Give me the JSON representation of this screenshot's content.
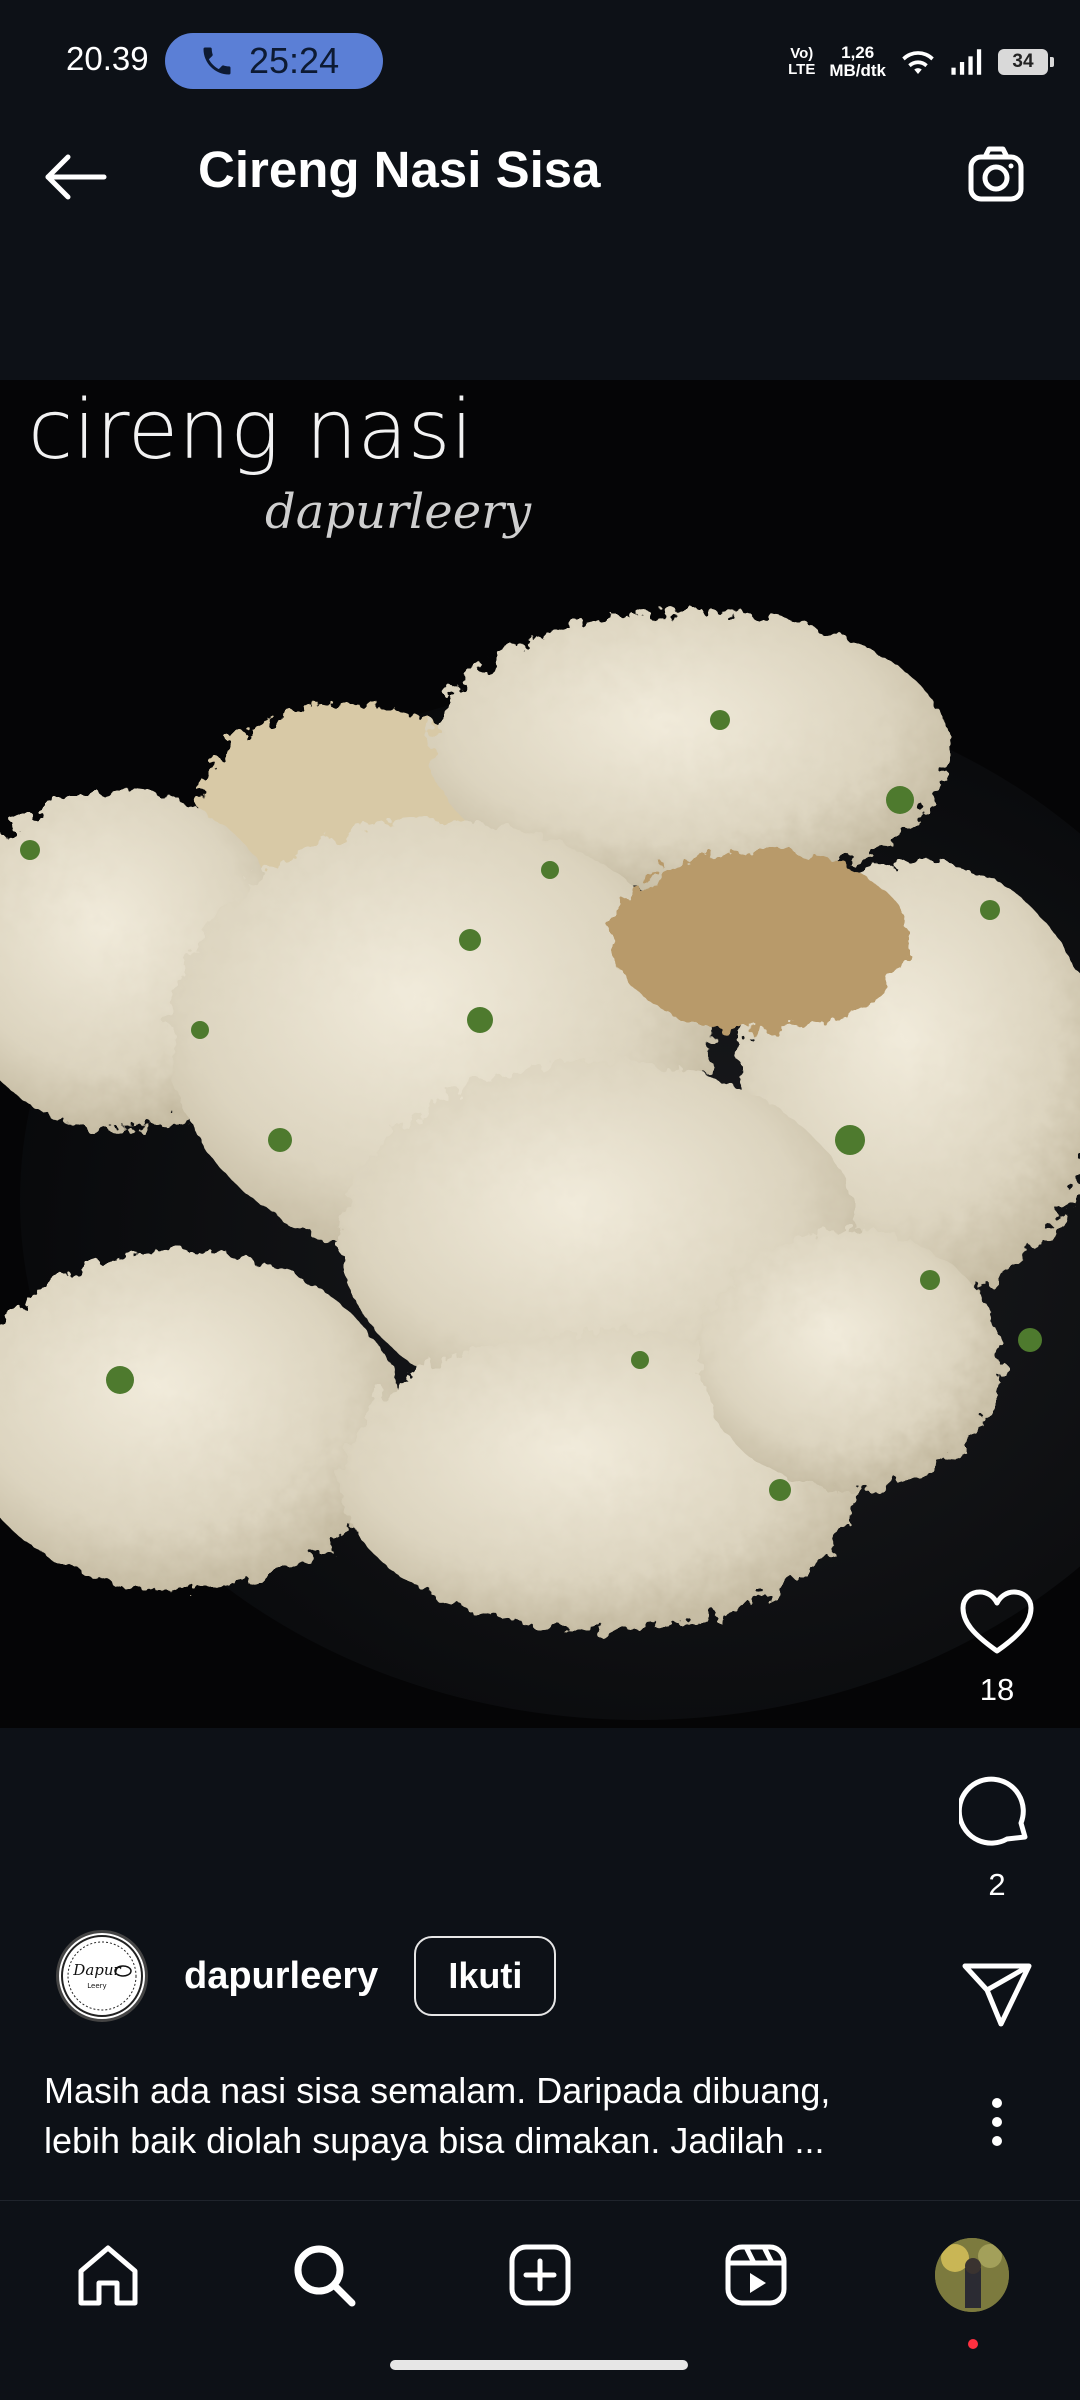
{
  "status_bar": {
    "time": "20.39",
    "call_duration": "25:24",
    "network_label_top": "Vo)",
    "network_label_bottom": "LTE",
    "speed_value": "1,26",
    "speed_unit": "MB/dtk",
    "battery": "34",
    "call_pill_color": "#5b7fd6"
  },
  "header": {
    "title": "Cireng Nasi Sisa",
    "back_icon": "arrow-left-icon",
    "camera_icon": "camera-icon"
  },
  "post": {
    "image_text_title": "cireng nasi",
    "image_text_watermark": "dapurleery",
    "likes": "18",
    "comments": "2",
    "author": {
      "username": "dapurleery",
      "follow_label": "Ikuti",
      "avatar_text": "Dapur",
      "avatar_subtext": "Leery"
    },
    "caption_lines": [
      "Masih ada nasi sisa semalam. Daripada dibuang,",
      "lebih baik diolah supaya bisa dimakan. Jadilah ..."
    ]
  },
  "bottom_nav": {
    "items": [
      {
        "icon": "home-icon"
      },
      {
        "icon": "search-icon"
      },
      {
        "icon": "add-post-icon"
      },
      {
        "icon": "reels-icon"
      },
      {
        "icon": "profile-avatar"
      }
    ],
    "notification_dot_color": "#ff3040"
  }
}
